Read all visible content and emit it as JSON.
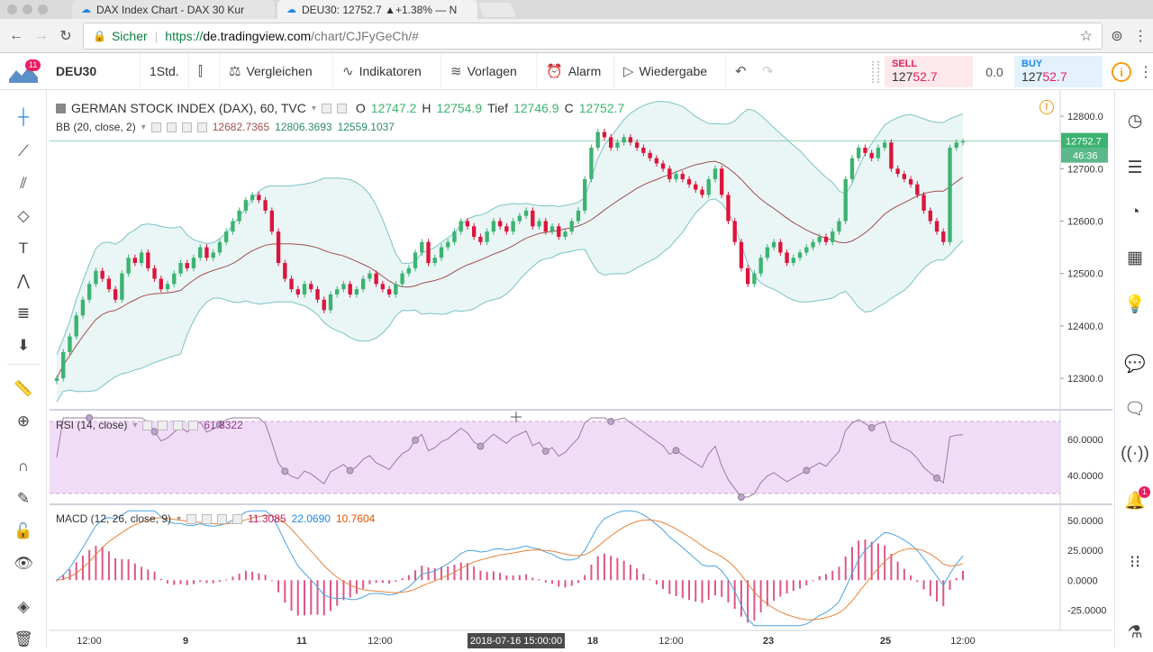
{
  "browser": {
    "tabs": [
      {
        "title": "DAX Index Chart - DAX 30 Kur",
        "active": false
      },
      {
        "title": "DEU30: 12752.7 ▲+1.38% — N",
        "active": true
      }
    ],
    "secure_label": "Sicher",
    "url_scheme": "https://",
    "url_host": "de.tradingview.com",
    "url_path": "/chart/CJFyGeCh/#"
  },
  "toolbar": {
    "logo_badge": "11",
    "symbol": "DEU30",
    "interval": "1Std.",
    "compare": "Vergleichen",
    "indicators": "Indikatoren",
    "templates": "Vorlagen",
    "alarm": "Alarm",
    "replay": "Wiedergabe",
    "sell_label": "SELL",
    "sell_prefix": "127",
    "sell_suffix": "52.7",
    "spread": "0.0",
    "buy_label": "BUY",
    "buy_prefix": "127",
    "buy_suffix": "52.7",
    "info": "i"
  },
  "right_badge": "1",
  "legend": {
    "title": "GERMAN STOCK INDEX (DAX), 60, TVC",
    "o_label": "O",
    "o_val": "12747.2",
    "h_label": "H",
    "h_val": "12754.9",
    "l_label": "Tief",
    "l_val": "12746.9",
    "c_label": "C",
    "c_val": "12752.7",
    "bb_label": "BB (20, close, 2)",
    "bb_mid": "12682.7365",
    "bb_up": "12806.3693",
    "bb_low": "12559.1037",
    "rsi_label": "RSI (14, close)",
    "rsi_val": "61.8322",
    "macd_label": "MACD (12, 26, close, 9)",
    "macd_hist": "11.3085",
    "macd_line": "22.0690",
    "macd_signal": "10.7604"
  },
  "chart_data": {
    "type": "candlestick",
    "price_axis": {
      "ticks": [
        "12800.0",
        "12700.0",
        "12600.0",
        "12500.0",
        "12400.0",
        "12300.0"
      ],
      "range": [
        12240,
        12850
      ]
    },
    "last_price": "12752.7",
    "countdown": "46:36",
    "rsi_axis": {
      "ticks": [
        "60.0000",
        "40.0000"
      ],
      "range": [
        25,
        75
      ]
    },
    "macd_axis": {
      "ticks": [
        "50.0000",
        "25.0000",
        "0.0000",
        "-25.0000"
      ],
      "range": [
        -42,
        62
      ]
    },
    "x_ticks": [
      "12:00",
      "9",
      "11",
      "12:00",
      "18",
      "12:00",
      "23",
      "25",
      "12:00"
    ],
    "crosshair_label": "2018-07-16 15:00:00",
    "colors": {
      "up": "#3cb371",
      "down": "#dc143c",
      "band": "#7cc3c3",
      "bandfill": "#eaf5f5",
      "basis": "#a05050",
      "rsi": "#9a7aa0",
      "rsi_bg": "#f1dcf8",
      "macd": "#4aa3df",
      "signal": "#e8833a",
      "hist": "#dd5588"
    },
    "closes": [
      12300,
      12350,
      12380,
      12420,
      12450,
      12480,
      12505,
      12490,
      12470,
      12450,
      12500,
      12530,
      12520,
      12540,
      12510,
      12490,
      12470,
      12480,
      12500,
      12520,
      12510,
      12530,
      12550,
      12530,
      12540,
      12560,
      12580,
      12600,
      12620,
      12640,
      12650,
      12640,
      12620,
      12580,
      12520,
      12490,
      12470,
      12460,
      12480,
      12470,
      12450,
      12430,
      12460,
      12470,
      12480,
      12460,
      12470,
      12490,
      12500,
      12480,
      12470,
      12460,
      12480,
      12500,
      12510,
      12540,
      12560,
      12520,
      12530,
      12550,
      12560,
      12580,
      12600,
      12590,
      12570,
      12560,
      12580,
      12600,
      12590,
      12580,
      12600,
      12610,
      12620,
      12590,
      12600,
      12580,
      12590,
      12570,
      12580,
      12600,
      12620,
      12680,
      12740,
      12770,
      12760,
      12740,
      12750,
      12760,
      12750,
      12740,
      12730,
      12720,
      12710,
      12700,
      12680,
      12690,
      12680,
      12670,
      12660,
      12650,
      12680,
      12700,
      12650,
      12600,
      12560,
      12510,
      12480,
      12500,
      12530,
      12550,
      12560,
      12540,
      12520,
      12530,
      12540,
      12550,
      12560,
      12570,
      12560,
      12580,
      12600,
      12680,
      12720,
      12740,
      12730,
      12720,
      12740,
      12750,
      12700,
      12690,
      12680,
      12670,
      12650,
      12620,
      12600,
      12580,
      12560,
      12740,
      12750,
      12752
    ]
  }
}
